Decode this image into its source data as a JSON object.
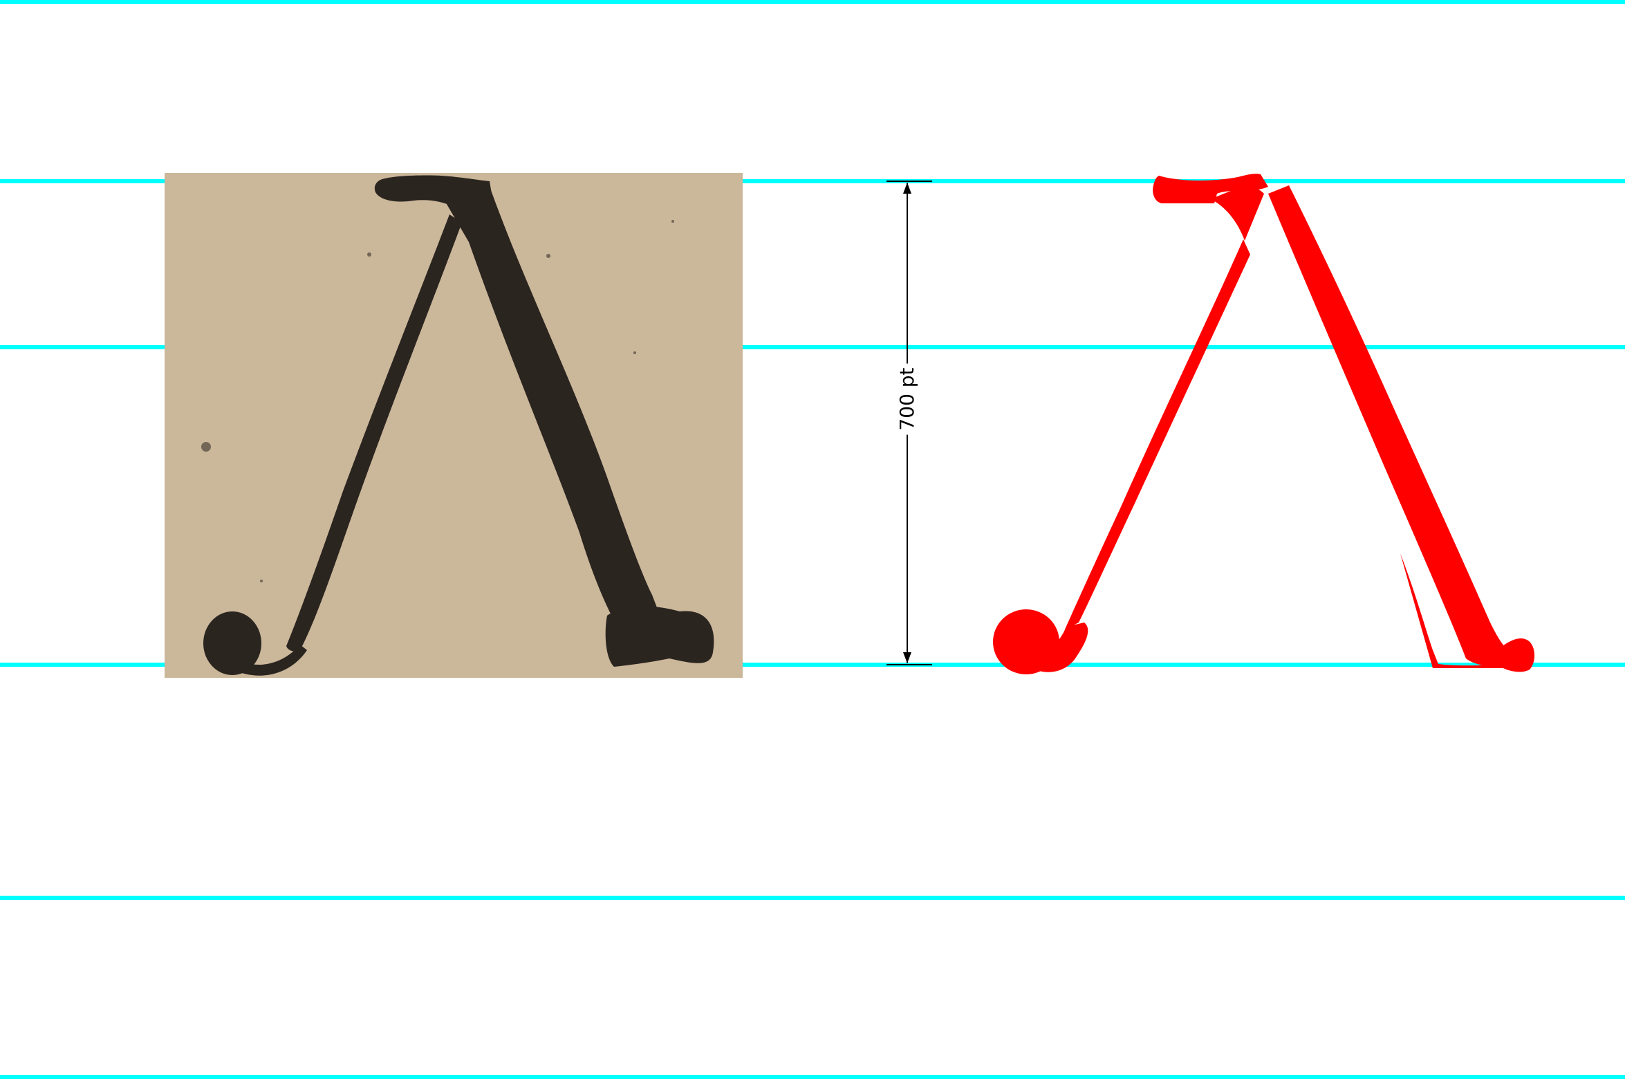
{
  "colors": {
    "guide": "#00ffff",
    "glyph_fill": "#ff0000",
    "paper": "#cbb79a",
    "ink": "#2b2520",
    "dimension": "#000000"
  },
  "guidelines": [
    "top-edge",
    "cap-height",
    "x-height",
    "baseline",
    "descender",
    "bottom-edge"
  ],
  "specimen": {
    "glyph_name": "lambda",
    "photo_label": "scanned-specimen"
  },
  "dimension": {
    "label": "700 pt"
  }
}
